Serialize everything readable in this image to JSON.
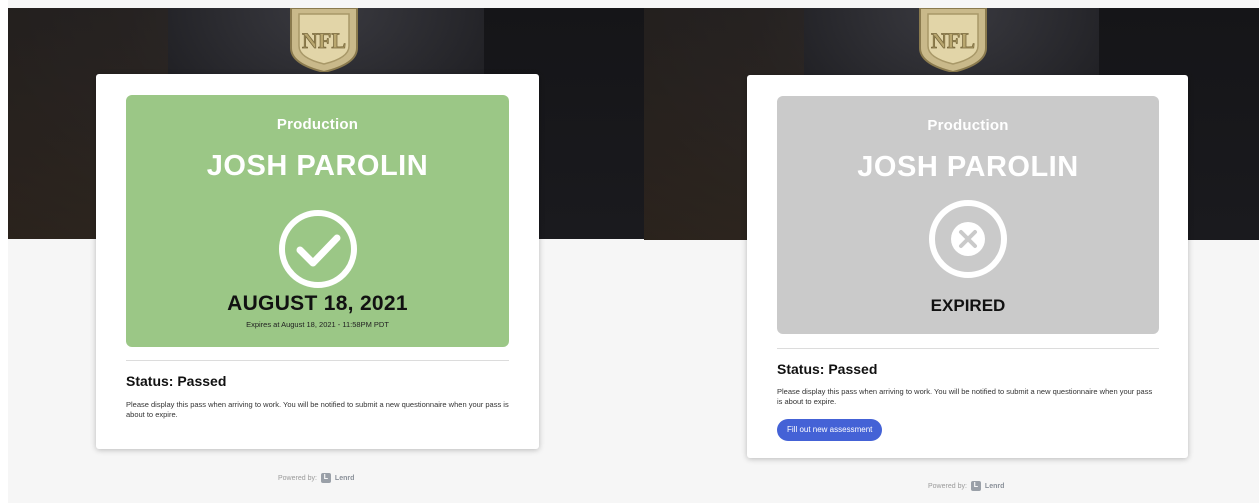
{
  "colors": {
    "passed_green": "#9bc786",
    "expired_gray": "#cacaca",
    "button_blue": "#4462d6"
  },
  "left_pass": {
    "department": "Production",
    "name": "JOSH PAROLIN",
    "icon": "check-circle-icon",
    "date": "AUGUST 18, 2021",
    "expires": "Expires at August 18, 2021 - 11:58PM PDT",
    "status": "Status: Passed",
    "notice": "Please display this pass when arriving to work. You will be notified to submit a new questionnaire when your pass is about to expire.",
    "powered_by": "Powered by:",
    "brand_logo": "L",
    "brand": "Lenrd"
  },
  "right_pass": {
    "department": "Production",
    "name": "JOSH PAROLIN",
    "icon": "x-circle-icon",
    "expired": "EXPIRED",
    "status": "Status: Passed",
    "notice": "Please display this pass when arriving to work. You will be notified to submit a new questionnaire when your pass is about to expire.",
    "button": "Fill out new assessment",
    "powered_by": "Powered by:",
    "brand_logo": "L",
    "brand": "Lenrd"
  },
  "logo_text": "NFL"
}
